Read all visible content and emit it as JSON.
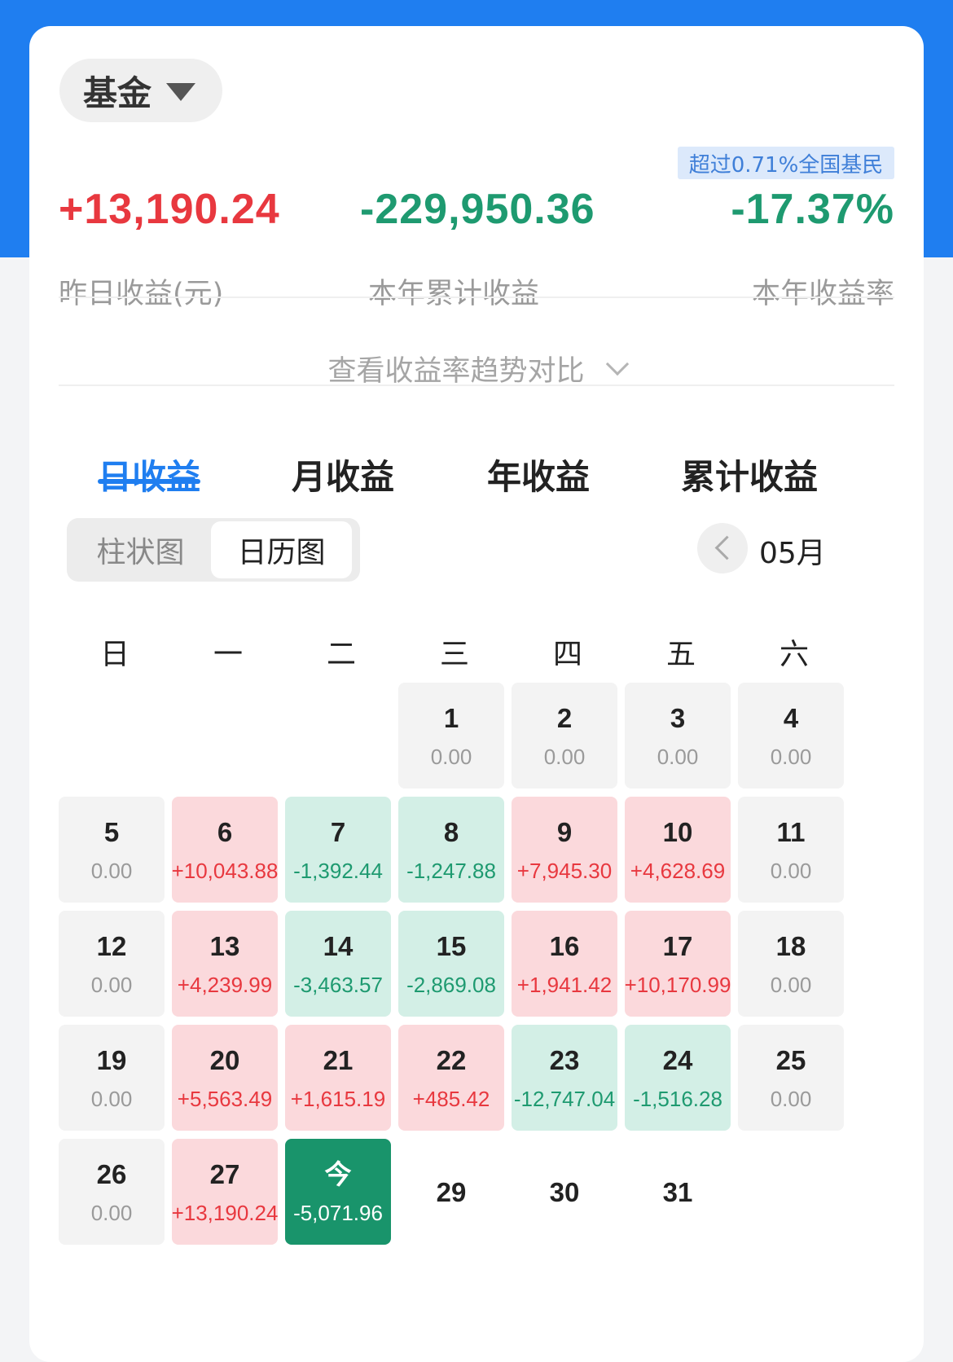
{
  "fund_selector": {
    "label": "基金"
  },
  "rank_badge": "超过0.71%全国基民",
  "stats": [
    {
      "value": "+13,190.24",
      "label": "昨日收益(元)"
    },
    {
      "value": "-229,950.36",
      "label": "本年累计收益"
    },
    {
      "value": "-17.37%",
      "label": "本年收益率"
    }
  ],
  "trend_toggle": "查看收益率趋势对比",
  "tabs": [
    "日收益",
    "月收益",
    "年收益",
    "累计收益"
  ],
  "active_tab": "日收益",
  "view_toggle": [
    "柱状图",
    "日历图"
  ],
  "active_view": "日历图",
  "month": "05月",
  "weekdays": [
    "日",
    "一",
    "二",
    "三",
    "四",
    "五",
    "六"
  ],
  "calendar": [
    {
      "day": "1",
      "value": "0.00"
    },
    {
      "day": "2",
      "value": "0.00"
    },
    {
      "day": "3",
      "value": "0.00"
    },
    {
      "day": "4",
      "value": "0.00"
    },
    {
      "day": "5",
      "value": "0.00"
    },
    {
      "day": "6",
      "value": "+10,043.88"
    },
    {
      "day": "7",
      "value": "-1,392.44"
    },
    {
      "day": "8",
      "value": "-1,247.88"
    },
    {
      "day": "9",
      "value": "+7,945.30"
    },
    {
      "day": "10",
      "value": "+4,628.69"
    },
    {
      "day": "11",
      "value": "0.00"
    },
    {
      "day": "12",
      "value": "0.00"
    },
    {
      "day": "13",
      "value": "+4,239.99"
    },
    {
      "day": "14",
      "value": "-3,463.57"
    },
    {
      "day": "15",
      "value": "-2,869.08"
    },
    {
      "day": "16",
      "value": "+1,941.42"
    },
    {
      "day": "17",
      "value": "+10,170.99"
    },
    {
      "day": "18",
      "value": "0.00"
    },
    {
      "day": "19",
      "value": "0.00"
    },
    {
      "day": "20",
      "value": "+5,563.49"
    },
    {
      "day": "21",
      "value": "+1,615.19"
    },
    {
      "day": "22",
      "value": "+485.42"
    },
    {
      "day": "23",
      "value": "-12,747.04"
    },
    {
      "day": "24",
      "value": "-1,516.28"
    },
    {
      "day": "25",
      "value": "0.00"
    },
    {
      "day": "26",
      "value": "0.00"
    },
    {
      "day": "27",
      "value": "+13,190.24"
    },
    {
      "day": "今",
      "value": "-5,071.96",
      "today": true
    },
    {
      "day": "29",
      "value": ""
    },
    {
      "day": "30",
      "value": ""
    },
    {
      "day": "31",
      "value": ""
    }
  ],
  "colors": {
    "brand_blue": "#1f7ef0",
    "gain_red": "#e8383f",
    "loss_green": "#1e9a70",
    "today_green": "#19946b"
  }
}
